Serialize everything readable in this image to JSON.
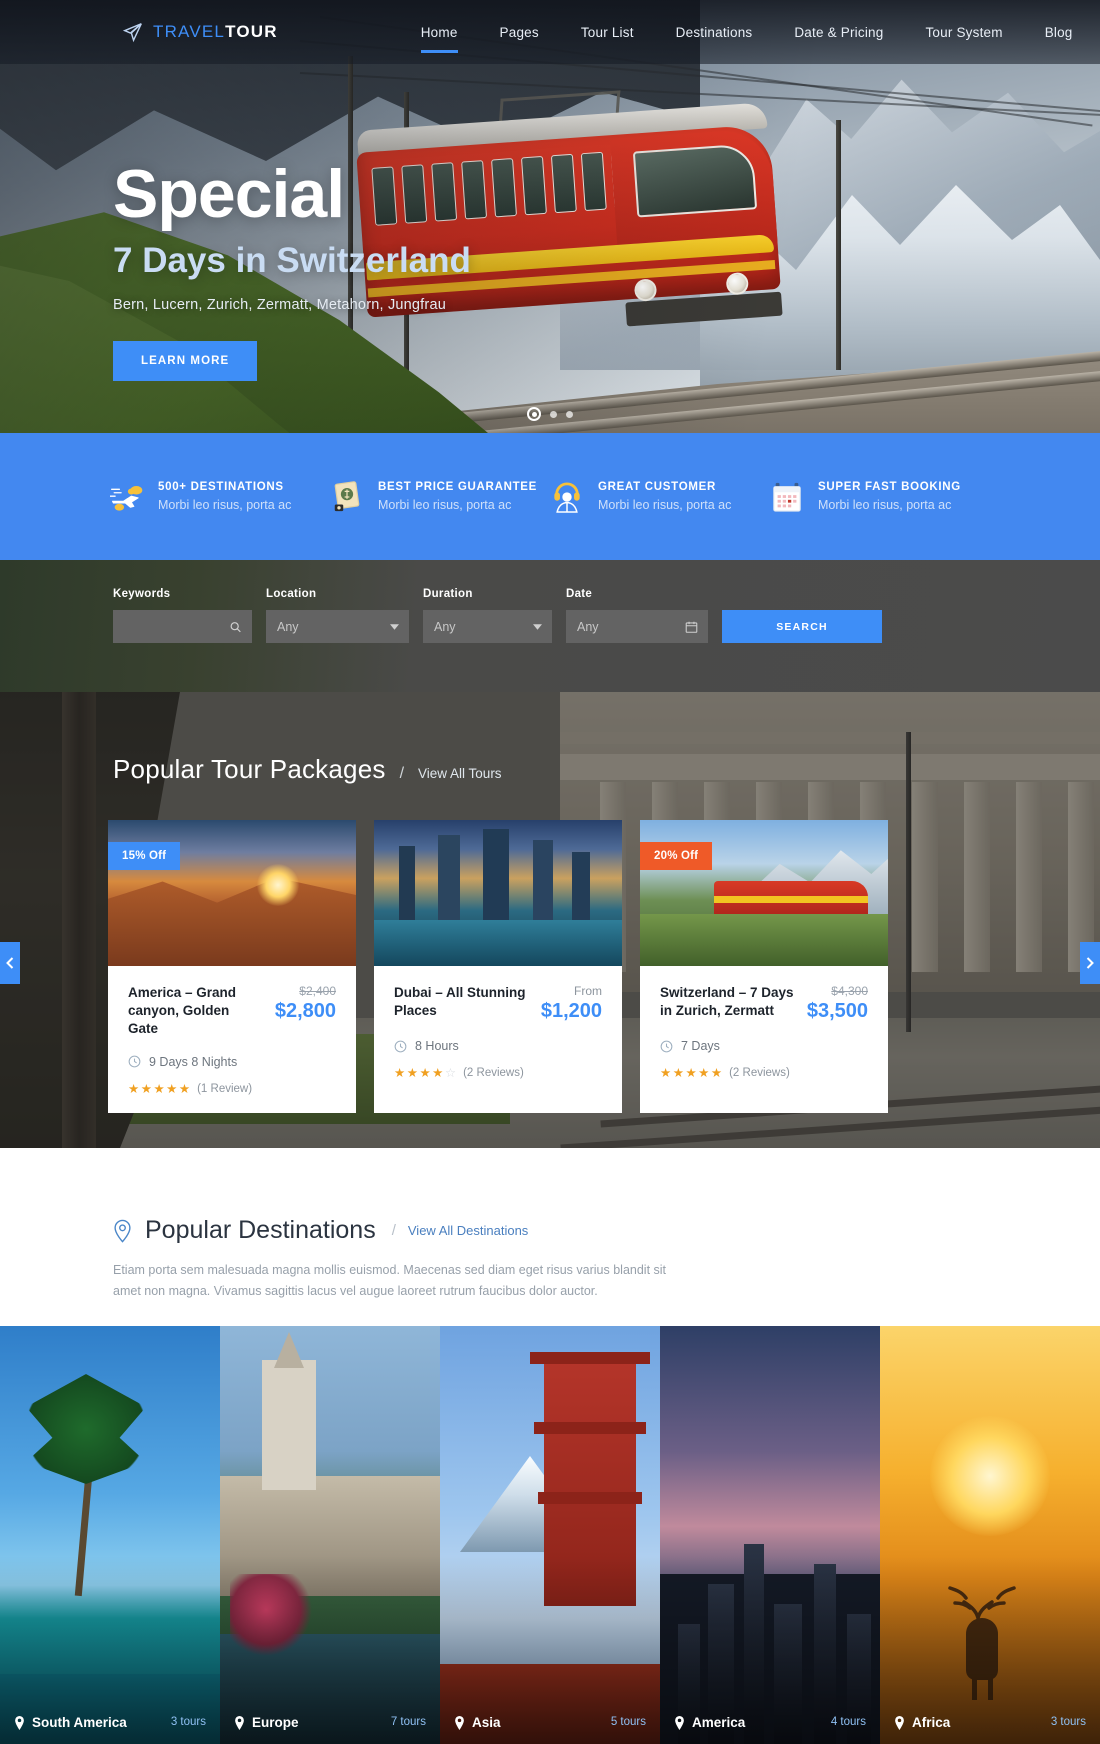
{
  "header": {
    "logo": {
      "part1": "TRAVEL",
      "part2": "TOUR",
      "icon": "paper-plane-icon"
    },
    "nav": [
      {
        "label": "Home",
        "active": true
      },
      {
        "label": "Pages",
        "active": false
      },
      {
        "label": "Tour List",
        "active": false
      },
      {
        "label": "Destinations",
        "active": false
      },
      {
        "label": "Date & Pricing",
        "active": false
      },
      {
        "label": "Tour System",
        "active": false
      },
      {
        "label": "Blog",
        "active": false
      }
    ],
    "search_icon": "search-icon"
  },
  "hero": {
    "title": "Special",
    "subtitle": "7 Days in Switzerland",
    "description": "Bern, Lucern, Zurich, Zermatt, Metahorn, Jungfrau",
    "cta_label": "LEARN MORE",
    "slides": 3,
    "active_slide": 1
  },
  "features": [
    {
      "icon": "plane-cloud-icon",
      "title": "500+ DESTINATIONS",
      "subtitle": "Morbi leo risus, porta ac"
    },
    {
      "icon": "money-tag-icon",
      "title": "BEST PRICE GUARANTEE",
      "subtitle": "Morbi leo risus, porta ac"
    },
    {
      "icon": "headset-agent-icon",
      "title": "GREAT CUSTOMER",
      "subtitle": "Morbi leo risus, porta ac"
    },
    {
      "icon": "calendar-icon",
      "title": "SUPER FAST BOOKING",
      "subtitle": "Morbi leo risus, porta ac"
    }
  ],
  "search": {
    "fields": [
      {
        "label": "Keywords",
        "value": "",
        "placeholder": "",
        "icon": "search-icon"
      },
      {
        "label": "Location",
        "value": "Any",
        "icon": "chevron-down-icon"
      },
      {
        "label": "Duration",
        "value": "Any",
        "icon": "chevron-down-icon"
      },
      {
        "label": "Date",
        "value": "Any",
        "icon": "calendar-icon"
      }
    ],
    "button_label": "SEARCH"
  },
  "tours": {
    "title": "Popular Tour Packages",
    "separator": "/",
    "view_all_label": "View All Tours",
    "cards": [
      {
        "badge": "15% Off",
        "badge_color": "#3e8ef7",
        "title": "America – Grand canyon, Golden Gate",
        "price_old": "$2,400",
        "price_from": "",
        "price": "$2,800",
        "duration": "9 Days 8 Nights",
        "stars": 5,
        "reviews": "(1 Review)"
      },
      {
        "badge": "",
        "badge_color": "",
        "title": "Dubai – All Stunning Places",
        "price_old": "",
        "price_from": "From",
        "price": "$1,200",
        "duration": "8 Hours",
        "stars": 4,
        "reviews": "(2 Reviews)"
      },
      {
        "badge": "20% Off",
        "badge_color": "#ef5a28",
        "title": "Switzerland – 7 Days in Zurich, Zermatt",
        "price_old": "$4,300",
        "price_from": "",
        "price": "$3,500",
        "duration": "7 Days",
        "stars": 5,
        "reviews": "(2 Reviews)"
      }
    ]
  },
  "destinations_section": {
    "pin_icon": "map-pin-icon",
    "title": "Popular Destinations",
    "separator": "/",
    "view_all_label": "View All Destinations",
    "description": "Etiam porta sem malesuada magna mollis euismod. Maecenas sed diam eget risus varius blandit sit amet non magna. Vivamus sagittis lacus vel augue laoreet rutrum faucibus dolor auctor."
  },
  "destination_tiles": [
    {
      "name": "South America",
      "count": "3 tours"
    },
    {
      "name": "Europe",
      "count": "7 tours"
    },
    {
      "name": "Asia",
      "count": "5 tours"
    },
    {
      "name": "America",
      "count": "4 tours"
    },
    {
      "name": "Africa",
      "count": "3 tours"
    }
  ],
  "colors": {
    "accent_blue": "#3e8ef7",
    "feature_bar": "#4388f0",
    "badge_orange": "#ef5a28",
    "star": "#f0a021",
    "searchbar_bg": "#4a4a4a"
  }
}
